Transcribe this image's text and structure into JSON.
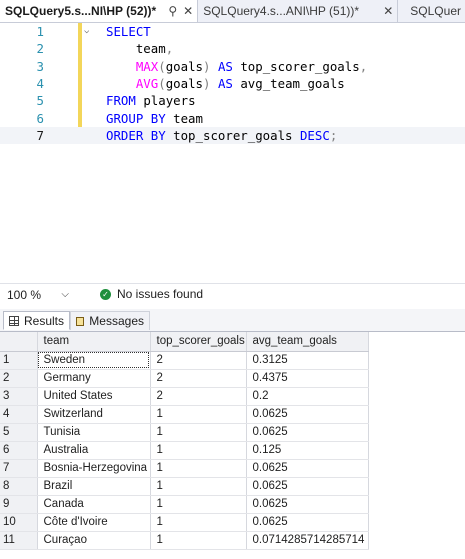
{
  "tabs": [
    {
      "label": "SQLQuery5.s...NI\\HP (52))*",
      "pin_icon": "pin-icon",
      "close_icon": "close-icon"
    },
    {
      "label": "SQLQuery4.s...ANI\\HP (51))*",
      "close_icon": "close-icon"
    },
    {
      "label": "SQLQuer"
    }
  ],
  "editor": {
    "lines": [
      {
        "num": "1",
        "tokens": [
          {
            "t": "SELECT",
            "c": "kw"
          }
        ]
      },
      {
        "num": "2",
        "tokens": [
          {
            "t": "    team",
            "c": "id"
          },
          {
            "t": ",",
            "c": "op"
          }
        ]
      },
      {
        "num": "3",
        "tokens": [
          {
            "t": "    ",
            "c": "id"
          },
          {
            "t": "MAX",
            "c": "fn"
          },
          {
            "t": "(",
            "c": "op"
          },
          {
            "t": "goals",
            "c": "id"
          },
          {
            "t": ")",
            "c": "op"
          },
          {
            "t": " AS ",
            "c": "kw"
          },
          {
            "t": "top_scorer_goals",
            "c": "id"
          },
          {
            "t": ",",
            "c": "op"
          }
        ]
      },
      {
        "num": "4",
        "tokens": [
          {
            "t": "    ",
            "c": "id"
          },
          {
            "t": "AVG",
            "c": "fn"
          },
          {
            "t": "(",
            "c": "op"
          },
          {
            "t": "goals",
            "c": "id"
          },
          {
            "t": ")",
            "c": "op"
          },
          {
            "t": " AS ",
            "c": "kw"
          },
          {
            "t": "avg_team_goals",
            "c": "id"
          }
        ]
      },
      {
        "num": "5",
        "tokens": [
          {
            "t": "FROM ",
            "c": "kw"
          },
          {
            "t": "players",
            "c": "id"
          }
        ]
      },
      {
        "num": "6",
        "tokens": [
          {
            "t": "GROUP BY ",
            "c": "kw"
          },
          {
            "t": "team",
            "c": "id"
          }
        ]
      },
      {
        "num": "7",
        "tokens": [
          {
            "t": "ORDER BY ",
            "c": "kw"
          },
          {
            "t": "top_scorer_goals ",
            "c": "id"
          },
          {
            "t": "DESC",
            "c": "kw"
          },
          {
            "t": ";",
            "c": "op"
          }
        ]
      }
    ],
    "current_line": 7
  },
  "status": {
    "zoom": "100 %",
    "issues": "No issues found"
  },
  "result_tabs": {
    "results": "Results",
    "messages": "Messages"
  },
  "grid": {
    "columns": [
      "team",
      "top_scorer_goals",
      "avg_team_goals"
    ],
    "rows": [
      [
        "1",
        "Sweden",
        "2",
        "0.3125"
      ],
      [
        "2",
        "Germany",
        "2",
        "0.4375"
      ],
      [
        "3",
        "United States",
        "2",
        "0.2"
      ],
      [
        "4",
        "Switzerland",
        "1",
        "0.0625"
      ],
      [
        "5",
        "Tunisia",
        "1",
        "0.0625"
      ],
      [
        "6",
        "Australia",
        "1",
        "0.125"
      ],
      [
        "7",
        "Bosnia-Herzegovina",
        "1",
        "0.0625"
      ],
      [
        "8",
        "Brazil",
        "1",
        "0.0625"
      ],
      [
        "9",
        "Canada",
        "1",
        "0.0625"
      ],
      [
        "10",
        "Côte d'Ivoire",
        "1",
        "0.0625"
      ],
      [
        "11",
        "Curaçao",
        "1",
        "0.0714285714285714"
      ]
    ]
  },
  "colors": {
    "keyword": "#0000ff",
    "function": "#ff00ff",
    "line_number": "#2b91af",
    "change_bar": "#f3d65a",
    "ok_green": "#1e8f3c"
  }
}
